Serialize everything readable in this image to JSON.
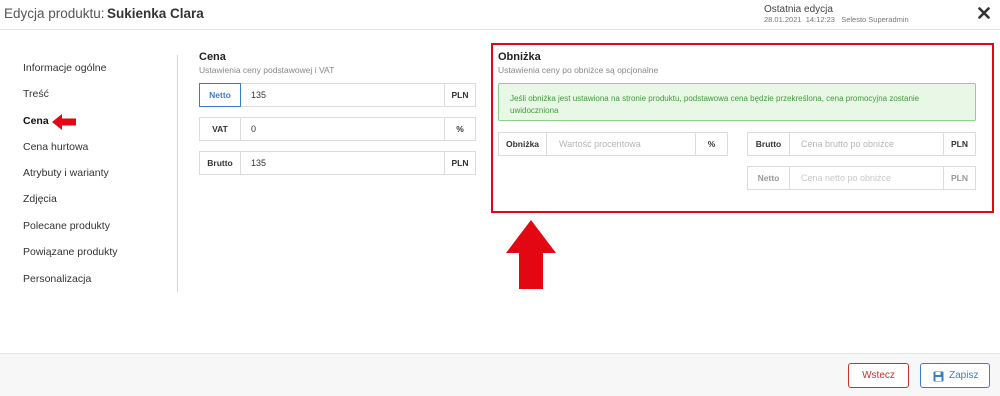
{
  "header": {
    "label": "Edycja produktu:",
    "product_name": "Sukienka Clara",
    "last_edit_title": "Ostatnia edycja",
    "last_edit_date": "28.01.2021",
    "last_edit_time": "14:12:23",
    "last_edit_user": "Selesto Superadmin",
    "close_icon": "close-icon"
  },
  "sidebar": {
    "items": [
      {
        "label": "Informacje ogólne"
      },
      {
        "label": "Treść"
      },
      {
        "label": "Cena"
      },
      {
        "label": "Cena hurtowa"
      },
      {
        "label": "Atrybuty i warianty"
      },
      {
        "label": "Zdjęcia"
      },
      {
        "label": "Polecane produkty"
      },
      {
        "label": "Powiązane produkty"
      },
      {
        "label": "Personalizacja"
      }
    ],
    "active_index": 2
  },
  "price": {
    "title": "Cena",
    "subtitle": "Ustawienia ceny podstawowej i VAT",
    "netto": {
      "label": "Netto",
      "value": "135",
      "unit": "PLN"
    },
    "vat": {
      "label": "VAT",
      "value": "0",
      "unit": "%"
    },
    "brutto": {
      "label": "Brutto",
      "value": "135",
      "unit": "PLN"
    }
  },
  "discount": {
    "title": "Obniżka",
    "subtitle": "Ustawienia ceny po obniżce są opcjonalne",
    "alert": "Jeśli obniżka jest ustawiona na stronie produktu, podstawowa cena będzie przekreślona, cena promocyjna zostanie uwidoczniona",
    "percent": {
      "label": "Obniżka",
      "placeholder": "Wartość procentowa",
      "unit": "%"
    },
    "brutto": {
      "label": "Brutto",
      "placeholder": "Cena brutto po obniżce",
      "unit": "PLN"
    },
    "netto": {
      "label": "Netto",
      "placeholder": "Cena netto po obniżce",
      "unit": "PLN"
    }
  },
  "footer": {
    "back_label": "Wstecz",
    "save_label": "Zapisz",
    "save_icon": "floppy-disk-icon"
  },
  "colors": {
    "annotation_red": "#e30613",
    "accent_blue": "#3a7fc4",
    "danger_red": "#c9302c",
    "alert_green_bg": "#e9f7e6",
    "alert_green_text": "#3f9b3a"
  }
}
